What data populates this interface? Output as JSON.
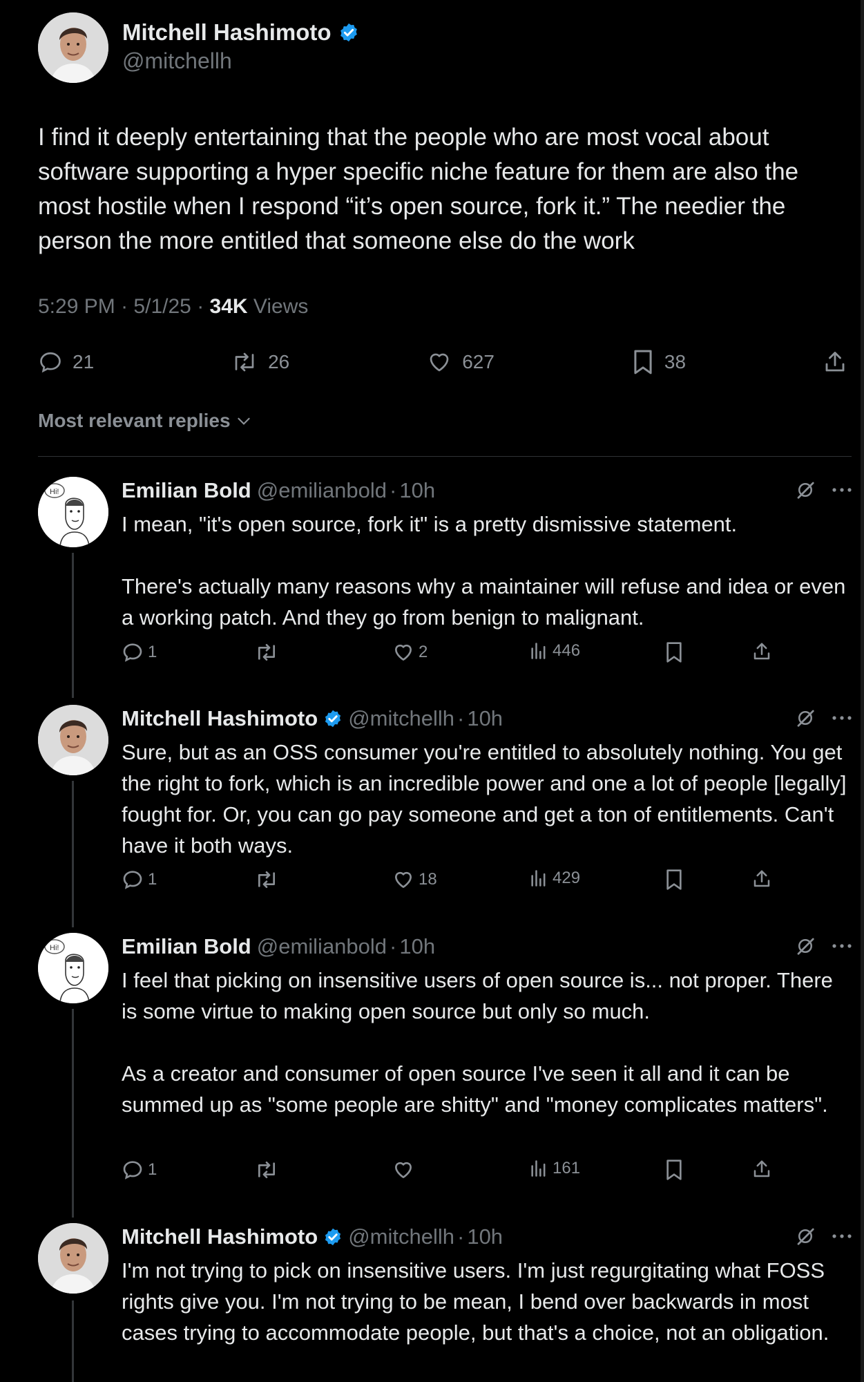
{
  "post": {
    "author_name": "Mitchell Hashimoto",
    "author_handle": "@mitchellh",
    "text": "I find it deeply entertaining that the people who are most vocal about software supporting a hyper specific niche feature for them are also the most hostile when I respond “it’s open source, fork it.” The needier the person the more entitled that someone else do the work",
    "time": "5:29 PM",
    "date": "5/1/25",
    "views_count": "34K",
    "views_label": "Views",
    "replies": "21",
    "reposts": "26",
    "likes": "627",
    "bookmarks": "38"
  },
  "sort_label": "Most relevant replies",
  "replies": [
    {
      "name": "Emilian Bold",
      "handle": "@emilianbold",
      "age": "10h",
      "verified": false,
      "text": "I mean, \"it's open source, fork it\" is a pretty dismissive statement.\n\nThere's actually many reasons why a maintainer will refuse and idea or even a working patch. And they go from benign to malignant.",
      "replies": "1",
      "reposts": "",
      "likes": "2",
      "views": "446"
    },
    {
      "name": "Mitchell Hashimoto",
      "handle": "@mitchellh",
      "age": "10h",
      "verified": true,
      "text": "Sure, but as an OSS consumer you're entitled to absolutely nothing. You get the right to fork, which is an incredible power and one a lot of people [legally] fought for. Or, you can go pay someone and get a ton of entitlements. Can't have it both ways.",
      "replies": "1",
      "reposts": "",
      "likes": "18",
      "views": "429"
    },
    {
      "name": "Emilian Bold",
      "handle": "@emilianbold",
      "age": "10h",
      "verified": false,
      "text": "I feel that picking on insensitive users of open source is... not proper. There is some virtue to making open source but only so much.\n\nAs a creator and consumer of open source I've seen it all and it can be summed up as \"some people are shitty\" and \"money complicates matters\".",
      "replies": "1",
      "reposts": "",
      "likes": "",
      "views": "161"
    },
    {
      "name": "Mitchell Hashimoto",
      "handle": "@mitchellh",
      "age": "10h",
      "verified": true,
      "text": "I'm not trying to pick on insensitive users. I'm just regurgitating what FOSS rights give you. I'm not trying to be mean, I bend over backwards in most cases trying to accommodate people, but that's a choice, not an obligation."
    }
  ],
  "separator": "·",
  "avatar_caption": "Hi!",
  "colors": {
    "background": "#000000",
    "text": "#e7e9ea",
    "muted": "#71767b",
    "verified": "#1d9bf0",
    "divider": "#2f3336"
  }
}
